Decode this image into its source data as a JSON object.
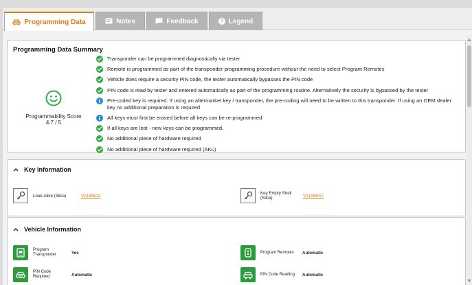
{
  "tabs": [
    {
      "label": "Programming Data",
      "icon": "car-icon",
      "active": true
    },
    {
      "label": "Notes",
      "icon": "note-icon",
      "active": false
    },
    {
      "label": "Feedback",
      "icon": "chat-icon",
      "active": false
    },
    {
      "label": "Legend",
      "icon": "help-icon",
      "active": false
    }
  ],
  "summary": {
    "title": "Programming Data Summary",
    "score_label": "Programmability Score",
    "score_value": "4.7 / 5",
    "items": [
      {
        "icon": "check-icon",
        "text": "Transponder can be programmed diagnostically via tester"
      },
      {
        "icon": "check-icon",
        "text": "Remote is programmed as part of the transponder programming procedure without the need to select Program Remotes"
      },
      {
        "icon": "check-icon",
        "text": "Vehicle does require a security PIN code, the tester automatically bypasses the PIN code"
      },
      {
        "icon": "check-icon",
        "text": "PIN code is read by tester and entered automatically as part of the programming routine. Alternatively the security is bypassed by the tester"
      },
      {
        "icon": "info-icon",
        "text": "Pre-coded key is required. If using an aftermarket key / transponder, the pre-coding will need to be written to this transponder. If using an OEM dealer key no additional preparation is required"
      },
      {
        "icon": "info-icon",
        "text": "All keys must first be erased before all keys can be re-programmed"
      },
      {
        "icon": "check-icon",
        "text": "If all keys are lost - new keys can be programmed."
      },
      {
        "icon": "check-icon",
        "text": "No additional piece of hardware required"
      },
      {
        "icon": "check-icon",
        "text": "No additional piece of hardware required (AKL)"
      }
    ]
  },
  "key_info": {
    "title": "Key Information",
    "keys": [
      {
        "label": "Look-Alike (Silca)",
        "link": "VA159513"
      },
      {
        "label": "Key Empty Shell (Silca)",
        "link": "VA159RS7"
      }
    ]
  },
  "vehicle_info": {
    "title": "Vehicle Information",
    "rows": [
      {
        "label": "Program Transponder",
        "value": "Yes"
      },
      {
        "label": "Program Remotes",
        "value": "Automatic"
      },
      {
        "label": "PIN Code Required",
        "value": "Automatic"
      },
      {
        "label": "PIN Code Reading",
        "value": "Automatic"
      }
    ]
  },
  "colors": {
    "accent": "#e07a14",
    "ok": "#34a843",
    "info": "#2f86c9",
    "panel_green": "#2e9c3d"
  }
}
